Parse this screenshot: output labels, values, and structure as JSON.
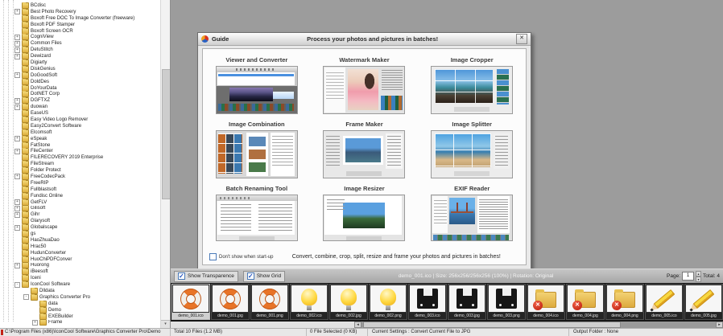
{
  "tree": {
    "items": [
      {
        "label": "BCdisc",
        "indent": 0,
        "box": null
      },
      {
        "label": "Best Photo Recovery",
        "indent": 0,
        "box": "+"
      },
      {
        "label": "Boxoft Free DOC To Image Converter (freeware)",
        "indent": 0,
        "box": null
      },
      {
        "label": "Boxoft PDF Stamper",
        "indent": 0,
        "box": null
      },
      {
        "label": "Boxoft Screen OCR",
        "indent": 0,
        "box": null
      },
      {
        "label": "CogniView",
        "indent": 0,
        "box": "+"
      },
      {
        "label": "Common Files",
        "indent": 0,
        "box": "+"
      },
      {
        "label": "DetuStitch",
        "indent": 0,
        "box": "+"
      },
      {
        "label": "Dewizard",
        "indent": 0,
        "box": "+"
      },
      {
        "label": "Digiarty",
        "indent": 0,
        "box": null
      },
      {
        "label": "DiskGenius",
        "indent": 0,
        "box": null
      },
      {
        "label": "DoGoodSoft",
        "indent": 0,
        "box": "+"
      },
      {
        "label": "DoldDes",
        "indent": 0,
        "box": null
      },
      {
        "label": "DoYourData",
        "indent": 0,
        "box": null
      },
      {
        "label": "DotNET Corp",
        "indent": 0,
        "box": null
      },
      {
        "label": "DGFTXZ",
        "indent": 0,
        "box": "+"
      },
      {
        "label": "duowan",
        "indent": 0,
        "box": "+"
      },
      {
        "label": "EaseUS",
        "indent": 0,
        "box": null
      },
      {
        "label": "Easy Video Logo Remover",
        "indent": 0,
        "box": null
      },
      {
        "label": "Easy2Convert Software",
        "indent": 0,
        "box": null
      },
      {
        "label": "Elcomsoft",
        "indent": 0,
        "box": null
      },
      {
        "label": "eSpeak",
        "indent": 0,
        "box": "+"
      },
      {
        "label": "FatStone",
        "indent": 0,
        "box": null
      },
      {
        "label": "FileCenter",
        "indent": 0,
        "box": "+"
      },
      {
        "label": "FILERECOVERY 2019 Enterprise",
        "indent": 0,
        "box": null
      },
      {
        "label": "FileStream",
        "indent": 0,
        "box": null
      },
      {
        "label": "Folder Protect",
        "indent": 0,
        "box": null
      },
      {
        "label": "FreeCodecPack",
        "indent": 0,
        "box": "+"
      },
      {
        "label": "FreeRIP",
        "indent": 0,
        "box": null
      },
      {
        "label": "Fullblastsoft",
        "indent": 0,
        "box": null
      },
      {
        "label": "Fundisc Online",
        "indent": 0,
        "box": null
      },
      {
        "label": "GetFLV",
        "indent": 0,
        "box": "+"
      },
      {
        "label": "Gilisoft",
        "indent": 0,
        "box": "+"
      },
      {
        "label": "Gihr",
        "indent": 0,
        "box": "+"
      },
      {
        "label": "Glarysoft",
        "indent": 0,
        "box": null
      },
      {
        "label": "Globalscape",
        "indent": 0,
        "box": "+"
      },
      {
        "label": "gs",
        "indent": 0,
        "box": null
      },
      {
        "label": "HaoZhuaDao",
        "indent": 0,
        "box": null
      },
      {
        "label": "Hrac50",
        "indent": 0,
        "box": null
      },
      {
        "label": "HudunConverter",
        "indent": 0,
        "box": null
      },
      {
        "label": "HuoChiPDFConver",
        "indent": 0,
        "box": null
      },
      {
        "label": "Huorong",
        "indent": 0,
        "box": "+"
      },
      {
        "label": "iBeesoft",
        "indent": 0,
        "box": null
      },
      {
        "label": "Iceni",
        "indent": 0,
        "box": null
      },
      {
        "label": "IconCool Software",
        "indent": 0,
        "box": "-"
      },
      {
        "label": "Dlldata",
        "indent": 1,
        "box": null
      },
      {
        "label": "Graphics Converter Pro",
        "indent": 1,
        "box": "-"
      },
      {
        "label": "data",
        "indent": 2,
        "box": null
      },
      {
        "label": "Demo",
        "indent": 2,
        "box": null
      },
      {
        "label": "EXEBuilder",
        "indent": 2,
        "box": null
      },
      {
        "label": "Frame",
        "indent": 2,
        "box": "+"
      }
    ]
  },
  "dialog": {
    "title": "Guide",
    "header_text": "Process your photos and pictures in batches!",
    "features": [
      {
        "title": "Viewer and Converter",
        "preview": "viewer-converter"
      },
      {
        "title": "Watermark Maker",
        "preview": "watermark-maker"
      },
      {
        "title": "Image Cropper",
        "preview": "image-cropper"
      },
      {
        "title": "Image Combination",
        "preview": "image-combination"
      },
      {
        "title": "Frame Maker",
        "preview": "frame-maker"
      },
      {
        "title": "Image Splitter",
        "preview": "image-splitter"
      },
      {
        "title": "Batch Renaming Tool",
        "preview": "batch-renaming-tool"
      },
      {
        "title": "Image Resizer",
        "preview": "image-resizer"
      },
      {
        "title": "EXIF Reader",
        "preview": "exif-reader"
      }
    ],
    "dont_show_label": "Don't show when start-up",
    "footer_text": "Convert, combine, crop, split, resize and frame your photos and pictures in batches!"
  },
  "toolbar": {
    "show_transparence_label": "Show Transparence",
    "show_grid_label": "Show Grid",
    "file_info": "demo_001.ico | Size: 256x256/256x256 (100%) | Rotation: Original",
    "page_label": "Page:",
    "page_value": "1",
    "total_label": "Total: 4"
  },
  "thumbnails": [
    {
      "name": "demo_001.ico",
      "icon": "lifebuoy",
      "selected": true
    },
    {
      "name": "demo_001.jpg",
      "icon": "lifebuoy",
      "selected": false
    },
    {
      "name": "demo_001.png",
      "icon": "lifebuoy",
      "selected": false
    },
    {
      "name": "demo_002.ico",
      "icon": "lightbulb",
      "selected": false
    },
    {
      "name": "demo_002.jpg",
      "icon": "lightbulb",
      "selected": false
    },
    {
      "name": "demo_002.png",
      "icon": "lightbulb",
      "selected": false
    },
    {
      "name": "demo_003.ico",
      "icon": "floppy",
      "selected": false
    },
    {
      "name": "demo_003.jpg",
      "icon": "floppy",
      "selected": false
    },
    {
      "name": "demo_003.png",
      "icon": "floppy",
      "selected": false
    },
    {
      "name": "demo_004.ico",
      "icon": "folder-error",
      "selected": false
    },
    {
      "name": "demo_004.jpg",
      "icon": "folder-error",
      "selected": false
    },
    {
      "name": "demo_004.png",
      "icon": "folder-error",
      "selected": false
    },
    {
      "name": "demo_005.ico",
      "icon": "pencil",
      "selected": false
    },
    {
      "name": "demo_005.jpg",
      "icon": "pencil",
      "selected": false
    }
  ],
  "statusbar": {
    "path": "C:\\Program Files (x86)\\IconCool Software\\Graphics Converter Pro\\Demo",
    "total_files": "Total 10 Files (1.2 MB)",
    "selected_files": "0 File Selected (0 KB)",
    "current_settings": "Current Settings : Convert Current File to JPG",
    "output_folder": "Output Folder : None"
  },
  "icons": {
    "close": "✕",
    "spin_up": "▴",
    "spin_down": "▾",
    "scroll_left": "◂",
    "scroll_right": "▸",
    "scroll_down": "▾"
  }
}
